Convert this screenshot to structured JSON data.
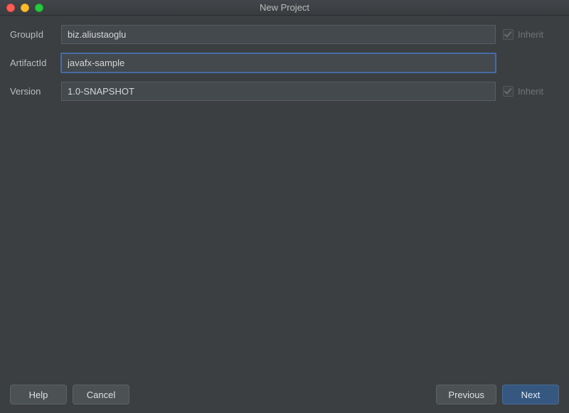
{
  "window": {
    "title": "New Project"
  },
  "form": {
    "groupId": {
      "label": "GroupId",
      "value": "biz.aliustaoglu",
      "inherit_label": "Inherit",
      "inherit": true
    },
    "artifactId": {
      "label": "ArtifactId",
      "value": "javafx-sample"
    },
    "version": {
      "label": "Version",
      "value": "1.0-SNAPSHOT",
      "inherit_label": "Inherit",
      "inherit": true
    }
  },
  "footer": {
    "help": "Help",
    "cancel": "Cancel",
    "previous": "Previous",
    "next": "Next"
  }
}
